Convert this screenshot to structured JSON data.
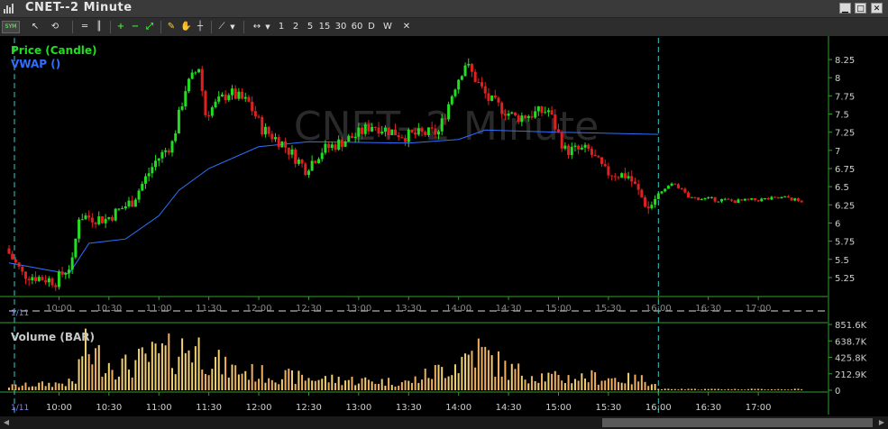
{
  "window": {
    "title": "CNET--2 Minute"
  },
  "toolbar": {
    "tf": [
      "1",
      "2",
      "5",
      "15",
      "30",
      "60",
      "D",
      "W"
    ],
    "close": "✕"
  },
  "watermark": "CNET--2 Minute",
  "legend": {
    "price": "Price (Candle)",
    "vwap": "VWAP ()",
    "volume": "Volume (BAR)"
  },
  "date_label": "1/11",
  "price_axis": [
    "8.25",
    "8",
    "7.75",
    "7.5",
    "7.25",
    "7",
    "6.75",
    "6.5",
    "6.25",
    "6",
    "5.75",
    "5.5",
    "5.25"
  ],
  "volume_axis": [
    "851.6K",
    "638.7K",
    "425.8K",
    "212.9K",
    "0"
  ],
  "time_axis": [
    "10:00",
    "10:30",
    "11:00",
    "11:30",
    "12:00",
    "12:30",
    "13:00",
    "13:30",
    "14:00",
    "14:30",
    "15:00",
    "15:30",
    "16:00",
    "16:30",
    "17:00"
  ],
  "colors": {
    "up": "#22dd22",
    "down": "#e02020",
    "vwap": "#3070ff",
    "volume": "#f0c060",
    "axis": "#30a030",
    "cursor": "#33cccc"
  },
  "chart_data": {
    "type": "candlestick",
    "ylim": [
      5.1,
      8.35
    ],
    "volume_max": 851.6,
    "time_range": [
      "09:30",
      "17:40"
    ],
    "cursor_time": "16:00",
    "keypoints": [
      [
        "09:30",
        5.65
      ],
      [
        "09:40",
        5.3
      ],
      [
        "10:00",
        5.2
      ],
      [
        "10:10",
        5.45
      ],
      [
        "10:14",
        6.1
      ],
      [
        "10:30",
        6.05
      ],
      [
        "10:46",
        6.3
      ],
      [
        "11:00",
        6.85
      ],
      [
        "11:10",
        7.1
      ],
      [
        "11:18",
        7.85
      ],
      [
        "11:26",
        8.15
      ],
      [
        "11:30",
        7.5
      ],
      [
        "11:44",
        7.8
      ],
      [
        "11:56",
        7.65
      ],
      [
        "12:04",
        7.3
      ],
      [
        "12:16",
        7.1
      ],
      [
        "12:30",
        6.75
      ],
      [
        "12:40",
        7.0
      ],
      [
        "13:00",
        7.2
      ],
      [
        "13:10",
        7.35
      ],
      [
        "13:30",
        7.2
      ],
      [
        "13:50",
        7.25
      ],
      [
        "14:00",
        7.9
      ],
      [
        "14:06",
        8.2
      ],
      [
        "14:20",
        7.7
      ],
      [
        "14:36",
        7.45
      ],
      [
        "14:56",
        7.55
      ],
      [
        "15:06",
        7.0
      ],
      [
        "15:20",
        7.0
      ],
      [
        "15:30",
        6.7
      ],
      [
        "15:44",
        6.65
      ],
      [
        "15:56",
        6.2
      ],
      [
        "16:02",
        6.4
      ],
      [
        "16:12",
        6.55
      ],
      [
        "16:20",
        6.35
      ],
      [
        "16:50",
        6.3
      ],
      [
        "17:20",
        6.35
      ],
      [
        "17:26",
        6.3
      ]
    ],
    "vwap": [
      [
        "09:30",
        5.45
      ],
      [
        "10:06",
        5.3
      ],
      [
        "10:18",
        5.72
      ],
      [
        "10:40",
        5.78
      ],
      [
        "11:00",
        6.1
      ],
      [
        "11:12",
        6.45
      ],
      [
        "11:30",
        6.75
      ],
      [
        "12:00",
        7.05
      ],
      [
        "12:30",
        7.12
      ],
      [
        "13:30",
        7.1
      ],
      [
        "14:00",
        7.15
      ],
      [
        "14:16",
        7.28
      ],
      [
        "15:00",
        7.25
      ],
      [
        "16:00",
        7.22
      ]
    ],
    "volume_profile": [
      [
        "09:30",
        60
      ],
      [
        "10:10",
        120
      ],
      [
        "10:14",
        620
      ],
      [
        "10:30",
        420
      ],
      [
        "10:40",
        360
      ],
      [
        "11:00",
        530
      ],
      [
        "11:10",
        560
      ],
      [
        "11:20",
        700
      ],
      [
        "11:40",
        330
      ],
      [
        "12:00",
        250
      ],
      [
        "12:30",
        180
      ],
      [
        "13:00",
        150
      ],
      [
        "13:30",
        120
      ],
      [
        "14:00",
        420
      ],
      [
        "14:10",
        620
      ],
      [
        "14:30",
        300
      ],
      [
        "15:00",
        180
      ],
      [
        "15:20",
        200
      ],
      [
        "15:40",
        170
      ],
      [
        "16:00",
        150
      ],
      [
        "16:04",
        25
      ],
      [
        "17:30",
        15
      ]
    ]
  }
}
